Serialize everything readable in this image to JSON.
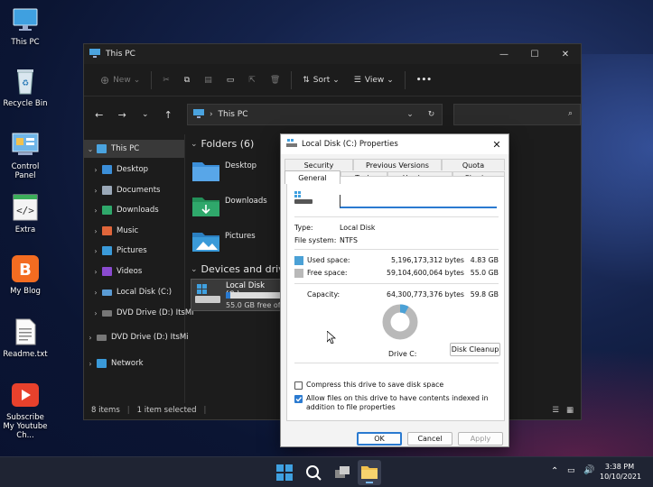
{
  "desktop": {
    "icons": [
      {
        "label": "This PC",
        "icon": "monitor-icon"
      },
      {
        "label": "Recycle Bin",
        "icon": "recycle-bin-icon"
      },
      {
        "label": "Control Panel",
        "icon": "control-panel-icon"
      },
      {
        "label": "Extra",
        "icon": "code-file-icon"
      },
      {
        "label": "My Blog",
        "icon": "blogger-icon"
      },
      {
        "label": "Readme.txt",
        "icon": "text-file-icon"
      },
      {
        "label": "Subscribe My Youtube Ch...",
        "icon": "youtube-icon"
      }
    ]
  },
  "explorer": {
    "title": "This PC",
    "commands": {
      "new": "New",
      "sort": "Sort",
      "view": "View",
      "more": "•••"
    },
    "address": "This PC",
    "tree": [
      {
        "label": "This PC",
        "icon": "monitor-icon",
        "color": "#4aa3df"
      },
      {
        "label": "Desktop",
        "icon": "desktop-icon",
        "color": "#3b8ed8"
      },
      {
        "label": "Documents",
        "icon": "documents-icon",
        "color": "#9aa8b8"
      },
      {
        "label": "Downloads",
        "icon": "downloads-icon",
        "color": "#2fa86b"
      },
      {
        "label": "Music",
        "icon": "music-icon",
        "color": "#e0663b"
      },
      {
        "label": "Pictures",
        "icon": "pictures-icon",
        "color": "#3a9ad9"
      },
      {
        "label": "Videos",
        "icon": "videos-icon",
        "color": "#8a4bd0"
      },
      {
        "label": "Local Disk (C:)",
        "icon": "drive-icon",
        "color": "#5a9bd4"
      },
      {
        "label": "DVD Drive (D:) ItsMi",
        "icon": "dvd-icon",
        "color": "#888"
      },
      {
        "label": "DVD Drive (D:) ItsMi",
        "icon": "dvd-icon",
        "color": "#888"
      },
      {
        "label": "Network",
        "icon": "network-icon",
        "color": "#3a9ad9"
      }
    ],
    "folders_header": "Folders (6)",
    "folders": [
      {
        "label": "Desktop",
        "color": "#3b8ed8"
      },
      {
        "label": "Downloads",
        "color": "#2fa86b"
      },
      {
        "label": "Pictures",
        "color": "#3a9ad9"
      }
    ],
    "devices_header": "Devices and drives",
    "drive": {
      "label": "Local Disk (C:)",
      "free": "55.0 GB free of",
      "used_fraction": 0.08
    },
    "status": {
      "items": "8 items",
      "selected": "1 item selected"
    }
  },
  "dialog": {
    "title": "Local Disk (C:) Properties",
    "tabs_top": [
      "Security",
      "Previous Versions",
      "Quota"
    ],
    "tabs_bottom": [
      "General",
      "Tools",
      "Hardware",
      "Sharing"
    ],
    "name_value": "",
    "type_label": "Type:",
    "type_value": "Local Disk",
    "fs_label": "File system:",
    "fs_value": "NTFS",
    "used_label": "Used space:",
    "used_bytes": "5,196,173,312 bytes",
    "used_gb": "4.83 GB",
    "free_label": "Free space:",
    "free_bytes": "59,104,600,064 bytes",
    "free_gb": "55.0 GB",
    "cap_label": "Capacity:",
    "cap_bytes": "64,300,773,376 bytes",
    "cap_gb": "59.8 GB",
    "used_fraction": 0.081,
    "drive_label": "Drive C:",
    "cleanup": "Disk Cleanup",
    "compress_label": "Compress this drive to save disk space",
    "compress_checked": false,
    "index_label": "Allow files on this drive to have contents indexed in addition to file properties",
    "index_checked": true,
    "ok": "OK",
    "cancel": "Cancel",
    "apply": "Apply",
    "colors": {
      "used": "#4ba1d6",
      "free": "#b9b9b9"
    }
  },
  "taskbar": {
    "time": "3:38 PM",
    "date": "10/10/2021"
  }
}
